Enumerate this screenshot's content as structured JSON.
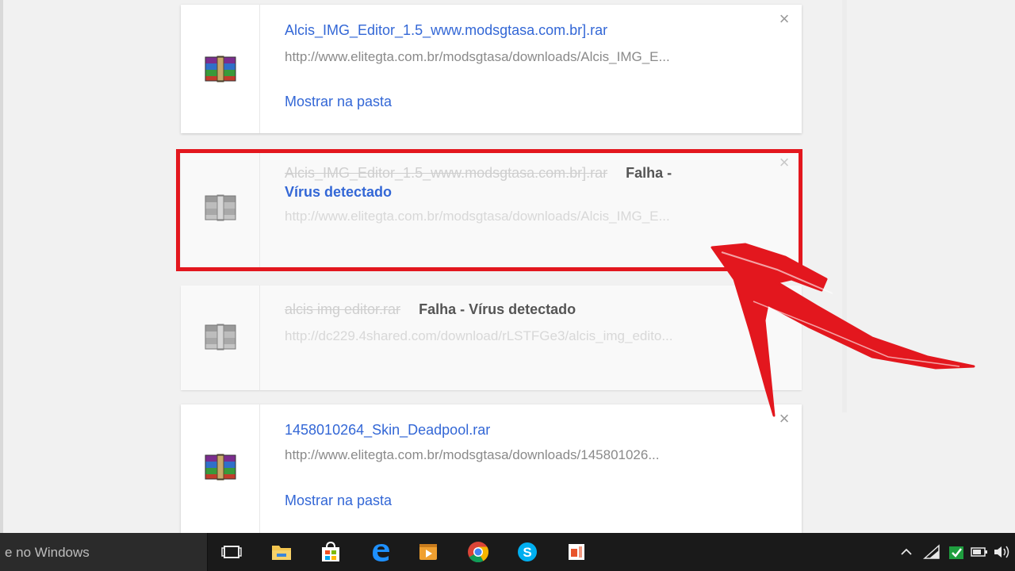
{
  "downloads": [
    {
      "title": "Alcis_IMG_Editor_1.5_www.modsgtasa.com.br].rar",
      "url": "http://www.elitegta.com.br/modsgtasa/downloads/Alcis_IMG_E...",
      "action": "Mostrar na pasta"
    },
    {
      "title": "Alcis_IMG_Editor_1.5_www.modsgtasa.com.br].rar",
      "status_line1": "Falha -",
      "status_line2": "Vírus detectado",
      "url": "http://www.elitegta.com.br/modsgtasa/downloads/Alcis_IMG_E..."
    },
    {
      "title": "alcis img editor.rar",
      "status": "Falha - Vírus detectado",
      "url": "http://dc229.4shared.com/download/rLSTFGe3/alcis_img_edito..."
    },
    {
      "title": "1458010264_Skin_Deadpool.rar",
      "url": "http://www.elitegta.com.br/modsgtasa/downloads/145801026...",
      "action": "Mostrar na pasta"
    }
  ],
  "close_glyph": "×",
  "taskbar": {
    "search_text": "e no Windows",
    "apps": [
      "task-view-icon",
      "file-explorer-icon",
      "store-icon",
      "edge-icon",
      "media-player-icon",
      "chrome-icon",
      "skype-icon",
      "office-icon"
    ]
  },
  "colors": {
    "link": "#3367d6",
    "highlight": "#e3171e",
    "taskbar": "#1a1a1a"
  }
}
